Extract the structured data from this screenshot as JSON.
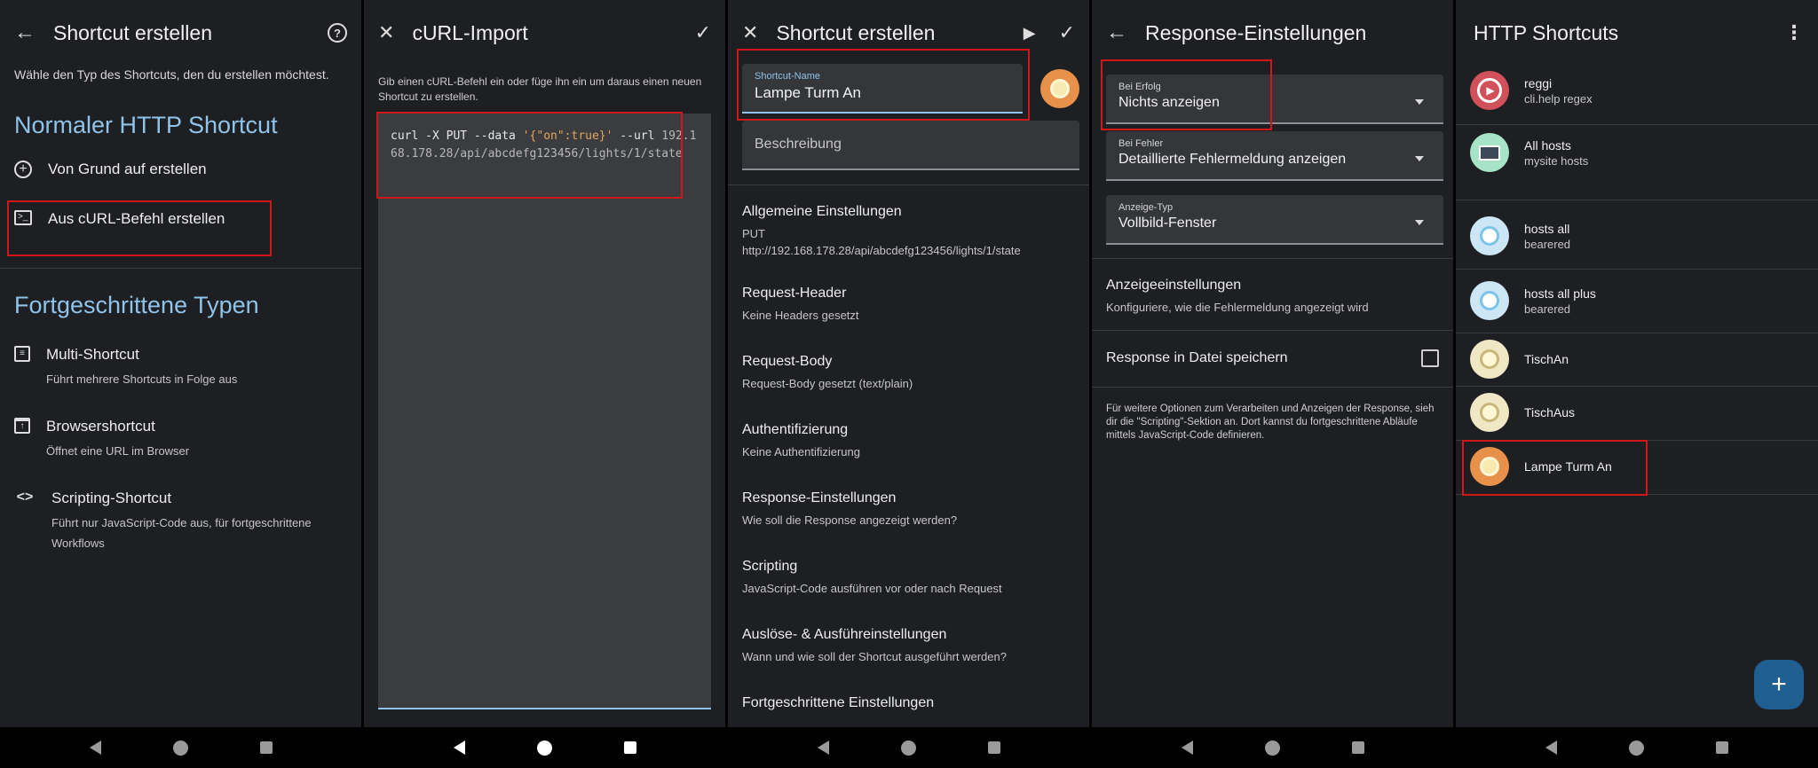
{
  "screen1": {
    "title": "Shortcut erstellen",
    "subtitle": "Wähle den Typ des Shortcuts, den du erstellen möchtest.",
    "section1": "Normaler HTTP Shortcut",
    "item_scratch": "Von Grund auf erstellen",
    "item_curl": "Aus cURL-Befehl erstellen",
    "section2": "Fortgeschrittene Typen",
    "multi_title": "Multi-Shortcut",
    "multi_desc": "Führt mehrere Shortcuts in Folge aus",
    "browser_title": "Browsershortcut",
    "browser_desc": "Öffnet eine URL im Browser",
    "scripting_title": "Scripting-Shortcut",
    "scripting_desc": "Führt nur JavaScript-Code aus, für fortgeschrittene Workflows"
  },
  "screen2": {
    "title": "cURL-Import",
    "description": "Gib einen cURL-Befehl ein oder füge ihn ein um daraus einen neuen Shortcut zu erstellen.",
    "code_cmd": "curl -X PUT --data ",
    "code_data": "'{\"on\":true}'",
    "code_url_flag": " --url",
    "code_url": "192.168.178.28/api/abcdefg123456/lights/1/state"
  },
  "screen3": {
    "title": "Shortcut erstellen",
    "name_label": "Shortcut-Name",
    "name_value": "Lampe Turm An",
    "description_placeholder": "Beschreibung",
    "general_title": "Allgemeine Einstellungen",
    "general_method": "PUT",
    "general_url": "http://192.168.178.28/api/abcdefg123456/lights/1/state",
    "header_title": "Request-Header",
    "header_desc": "Keine Headers gesetzt",
    "body_title": "Request-Body",
    "body_desc": "Request-Body gesetzt (text/plain)",
    "auth_title": "Authentifizierung",
    "auth_desc": "Keine Authentifizierung",
    "response_title": "Response-Einstellungen",
    "response_desc": "Wie soll die Response angezeigt werden?",
    "scripting_title": "Scripting",
    "scripting_desc": "JavaScript-Code ausführen vor oder nach Request",
    "trigger_title": "Auslöse- & Ausführeinstellungen",
    "trigger_desc": "Wann und wie soll der Shortcut ausgeführt werden?",
    "advanced_title": "Fortgeschrittene Einstellungen"
  },
  "screen4": {
    "title": "Response-Einstellungen",
    "success_label": "Bei Erfolg",
    "success_value": "Nichts anzeigen",
    "failure_label": "Bei Fehler",
    "failure_value": "Detaillierte Fehlermeldung anzeigen",
    "display_label": "Anzeige-Typ",
    "display_value": "Vollbild-Fenster",
    "display_settings_title": "Anzeigeeinstellungen",
    "display_settings_desc": "Konfiguriere, wie die Fehlermeldung angezeigt wird",
    "save_file_label": "Response in Datei speichern",
    "footer_note": "Für weitere Optionen zum Verarbeiten und Anzeigen der Response, sieh dir die \"Scripting\"-Sektion an. Dort kannst du fortgeschrittene Abläufe mittels JavaScript-Code definieren."
  },
  "screen5": {
    "title": "HTTP Shortcuts",
    "items": [
      {
        "name": "reggi",
        "sub": "cli.help regex"
      },
      {
        "name": "All hosts",
        "sub": "mysite hosts"
      },
      {
        "name": "hosts all",
        "sub": "bearered"
      },
      {
        "name": "hosts all plus",
        "sub": "bearered"
      },
      {
        "name": "TischAn",
        "sub": ""
      },
      {
        "name": "TischAus",
        "sub": ""
      },
      {
        "name": "Lampe Turm An",
        "sub": ""
      }
    ],
    "fab_label": "+"
  },
  "colors": {
    "accent_blue": "#8fc3ea",
    "highlight_red": "#d31616",
    "fab": "#1e5f8f",
    "background": "#1e1f22",
    "curl_string": "#e5a559"
  },
  "icons": [
    "back-arrow-icon",
    "help-icon",
    "close-icon",
    "check-icon",
    "play-icon",
    "plus-circle-icon",
    "terminal-icon",
    "list-icon",
    "browser-icon",
    "code-icon",
    "lightbulb-icon",
    "monitor-icon",
    "play-circle-icon",
    "overflow-menu-icon",
    "plus-icon",
    "checkbox-icon",
    "dropdown-arrow-icon"
  ]
}
